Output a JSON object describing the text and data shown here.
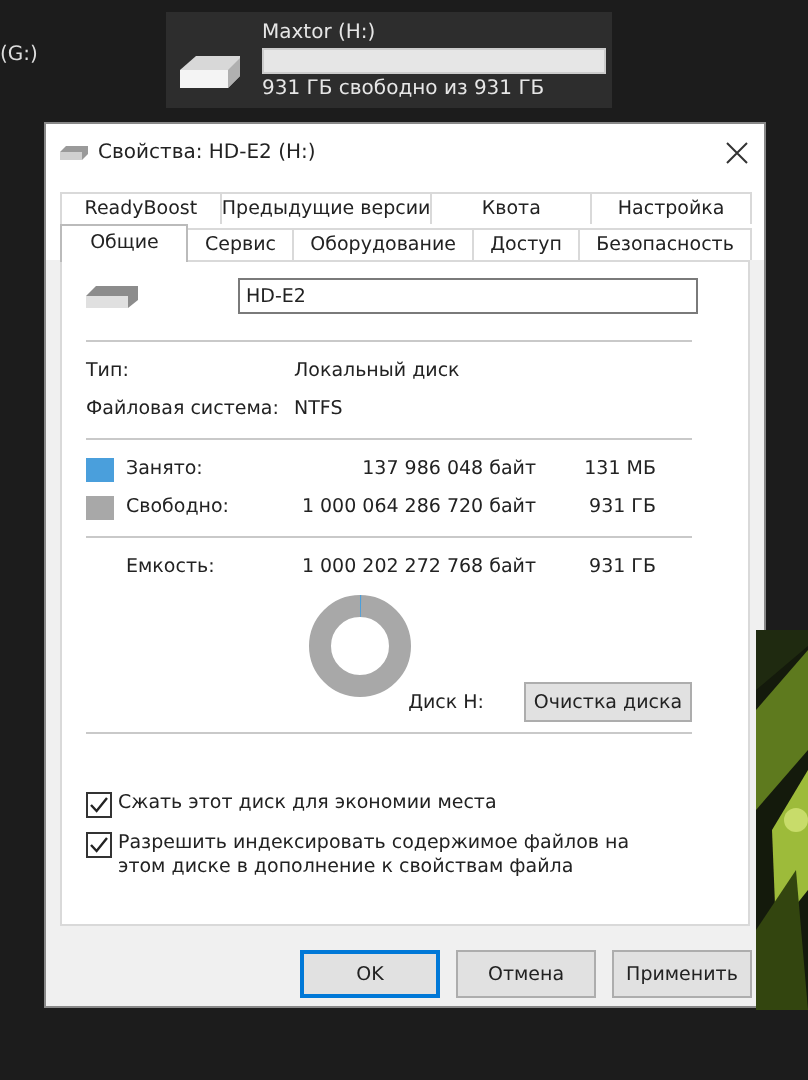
{
  "desktop": {
    "drive_g_label": "(G:)",
    "drive_tile": {
      "name": "Maxtor (H:)",
      "level": 0.0,
      "free_text": "931 ГБ свободно из 931 ГБ"
    }
  },
  "dialog": {
    "title": "Свойства: HD-E2 (H:)",
    "tab_rows": [
      [
        {
          "label": "ReadyBoost",
          "selected": false
        },
        {
          "label": "Предыдущие версии",
          "selected": false
        },
        {
          "label": "Квота",
          "selected": false
        },
        {
          "label": "Настройка",
          "selected": false
        }
      ],
      [
        {
          "label": "Общие",
          "selected": true
        },
        {
          "label": "Сервис",
          "selected": false
        },
        {
          "label": "Оборудование",
          "selected": false
        },
        {
          "label": "Доступ",
          "selected": false
        },
        {
          "label": "Безопасность",
          "selected": false
        }
      ]
    ],
    "name_value": "HD-E2",
    "info": [
      {
        "label": "Тип:",
        "value": "Локальный диск"
      },
      {
        "label": "Файловая система:",
        "value": "NTFS"
      }
    ],
    "usage": [
      {
        "label": "Занято:",
        "bytes": "137 986 048 байт",
        "size": "131 МБ",
        "color": "#4a9fdc"
      },
      {
        "label": "Свободно:",
        "bytes": "1 000 064 286 720 байт",
        "size": "931 ГБ",
        "color": "#a8a8a8"
      }
    ],
    "capacity": {
      "label": "Емкость:",
      "bytes": "1 000 202 272 768 байт",
      "size": "931 ГБ"
    },
    "disk_label": "Диск H:",
    "cleanup_button": "Очистка диска",
    "options": [
      {
        "label": "Сжать этот диск для экономии места",
        "checked": true
      },
      {
        "label": "Разрешить индексировать содержимое файлов на этом диске в дополнение к свойствам файла",
        "checked": true
      }
    ],
    "buttons": [
      {
        "label": "OK",
        "kind": "default"
      },
      {
        "label": "Отмена",
        "kind": "normal"
      },
      {
        "label": "Применить",
        "kind": "normal"
      }
    ]
  }
}
